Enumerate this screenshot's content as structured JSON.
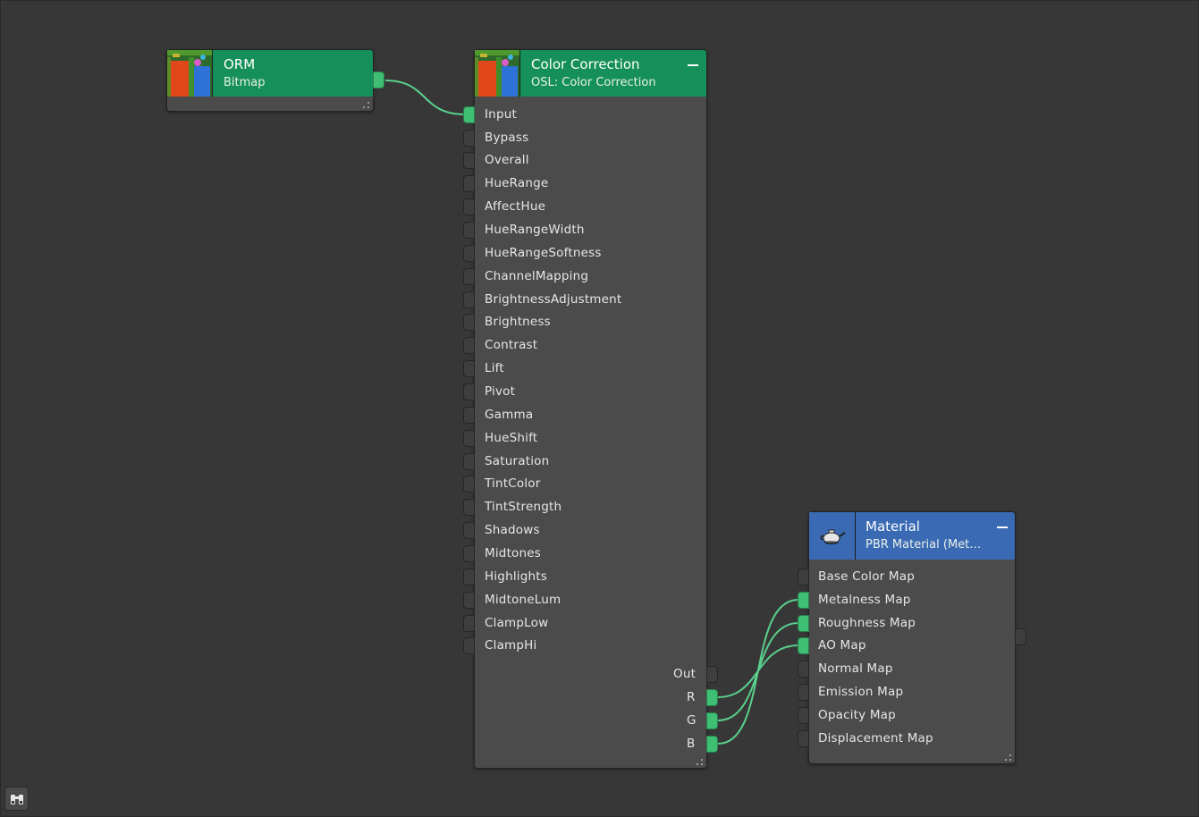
{
  "colors": {
    "canvas": "#373737",
    "node_body": "#4b4b4b",
    "header_green": "#16905a",
    "header_blue": "#3a6ab3",
    "wire": "#5ad18d",
    "socket_on": "#3fbf74"
  },
  "nodes": {
    "orm": {
      "title": "ORM",
      "subtitle": "Bitmap",
      "thumbnail_icon": "texture-thumbnail-icon"
    },
    "color_correction": {
      "title": "Color Correction",
      "subtitle": "OSL: Color Correction",
      "inputs": [
        "Input",
        "Bypass",
        "Overall",
        "HueRange",
        "AffectHue",
        "HueRangeWidth",
        "HueRangeSoftness",
        "ChannelMapping",
        "BrightnessAdjustment",
        "Brightness",
        "Contrast",
        "Lift",
        "Pivot",
        "Gamma",
        "HueShift",
        "Saturation",
        "TintColor",
        "TintStrength",
        "Shadows",
        "Midtones",
        "Highlights",
        "MidtoneLum",
        "ClampLow",
        "ClampHi"
      ],
      "outputs": [
        "Out",
        "R",
        "G",
        "B"
      ]
    },
    "material": {
      "title": "Material",
      "subtitle": "PBR Material (Met…",
      "icon": "teapot-icon",
      "inputs": [
        "Base Color Map",
        "Metalness Map",
        "Roughness Map",
        "AO Map",
        "Normal Map",
        "Emission Map",
        "Opacity Map",
        "Displacement Map"
      ]
    }
  },
  "connections": [
    {
      "from": "ORM.out",
      "to": "Color Correction.Input"
    },
    {
      "from": "Color Correction.R",
      "to": "Material.AO Map"
    },
    {
      "from": "Color Correction.G",
      "to": "Material.Roughness Map"
    },
    {
      "from": "Color Correction.B",
      "to": "Material.Metalness Map"
    }
  ],
  "toolbar": {
    "find_icon": "binoculars-icon"
  }
}
